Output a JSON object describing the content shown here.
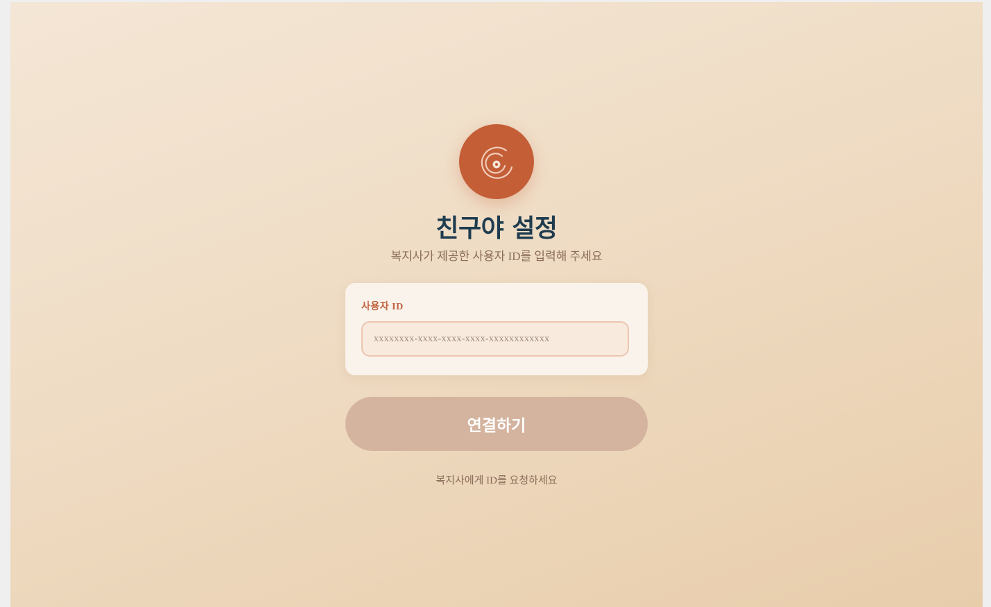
{
  "logo": {
    "icon": "vinyl-record-icon",
    "color": "#c45e37"
  },
  "heading": {
    "title": "친구야 설정",
    "subtitle": "복지사가 제공한 사용자 ID를 입력해 주세요"
  },
  "form": {
    "label": "사용자 ID",
    "input": {
      "value": "",
      "placeholder": "xxxxxxxx-xxxx-xxxx-xxxx-xxxxxxxxxxxx"
    },
    "submit_label": "연결하기"
  },
  "footer": {
    "hint": "복지사에게 ID를 요청하세요"
  },
  "colors": {
    "accent": "#c45e37",
    "title": "#1f3c4f",
    "button_disabled": "#d4b49f",
    "background": "#f1e0cb"
  }
}
